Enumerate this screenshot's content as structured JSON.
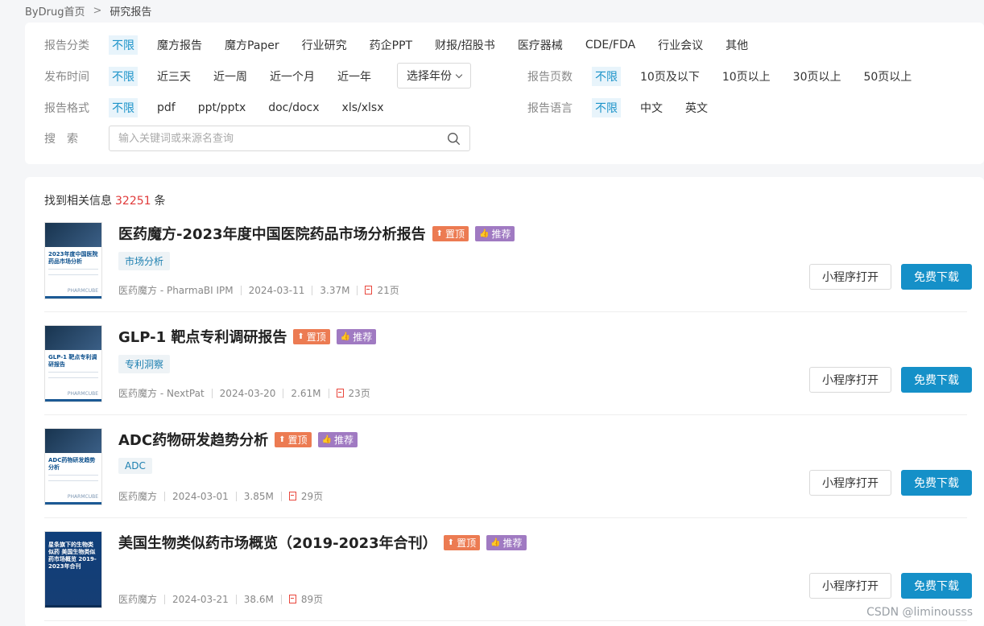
{
  "breadcrumb": {
    "home": "ByDrug首页",
    "separator": ">",
    "current": "研究报告"
  },
  "filters": {
    "category": {
      "label": "报告分类",
      "options": [
        "不限",
        "魔方报告",
        "魔方Paper",
        "行业研究",
        "药企PPT",
        "财报/招股书",
        "医疗器械",
        "CDE/FDA",
        "行业会议",
        "其他"
      ]
    },
    "time": {
      "label": "发布时间",
      "options": [
        "不限",
        "近三天",
        "近一周",
        "近一个月",
        "近一年"
      ],
      "year_select": "选择年份"
    },
    "pages": {
      "label": "报告页数",
      "options": [
        "不限",
        "10页及以下",
        "10页以上",
        "30页以上",
        "50页以上"
      ]
    },
    "format": {
      "label": "报告格式",
      "options": [
        "不限",
        "pdf",
        "ppt/pptx",
        "doc/docx",
        "xls/xlsx"
      ]
    },
    "language": {
      "label": "报告语言",
      "options": [
        "不限",
        "中文",
        "英文"
      ]
    },
    "search": {
      "label": "搜　索",
      "placeholder": "输入关键词或来源名查询"
    }
  },
  "results": {
    "count_prefix": "找到相关信息",
    "count": "32251",
    "count_suffix": "条",
    "badge_top": "置顶",
    "badge_rec": "推荐",
    "btn_mini": "小程序打开",
    "btn_download": "免费下载",
    "items": [
      {
        "title": "医药魔方-2023年度中国医院药品市场分析报告",
        "tag": "市场分析",
        "source": "医药魔方 - PharmaBI IPM",
        "date": "2024-03-11",
        "size": "3.37M",
        "pages": "21页",
        "thumb_title": "2023年度中国医院药品市场分析",
        "thumb_brand": "PHARMCUBE"
      },
      {
        "title": "GLP-1 靶点专利调研报告",
        "tag": "专利洞察",
        "source": "医药魔方 - NextPat",
        "date": "2024-03-20",
        "size": "2.61M",
        "pages": "23页",
        "thumb_title": "GLP-1 靶点专利调研报告",
        "thumb_brand": "PHARMCUBE"
      },
      {
        "title": "ADC药物研发趋势分析",
        "tag": "ADC",
        "source": "医药魔方",
        "date": "2024-03-01",
        "size": "3.85M",
        "pages": "29页",
        "thumb_title": "ADC药物研发趋势分析",
        "thumb_brand": "PHARMCUBE"
      },
      {
        "title": "美国生物类似药市场概览（2019-2023年合刊）",
        "tag": "",
        "source": "医药魔方",
        "date": "2024-03-21",
        "size": "38.6M",
        "pages": "89页",
        "thumb_title": "星条旗下的生物类似药 美国生物类似药市场概览 2019-2023年合刊",
        "thumb_brand": ""
      }
    ]
  },
  "watermark": "CSDN @liminousss"
}
